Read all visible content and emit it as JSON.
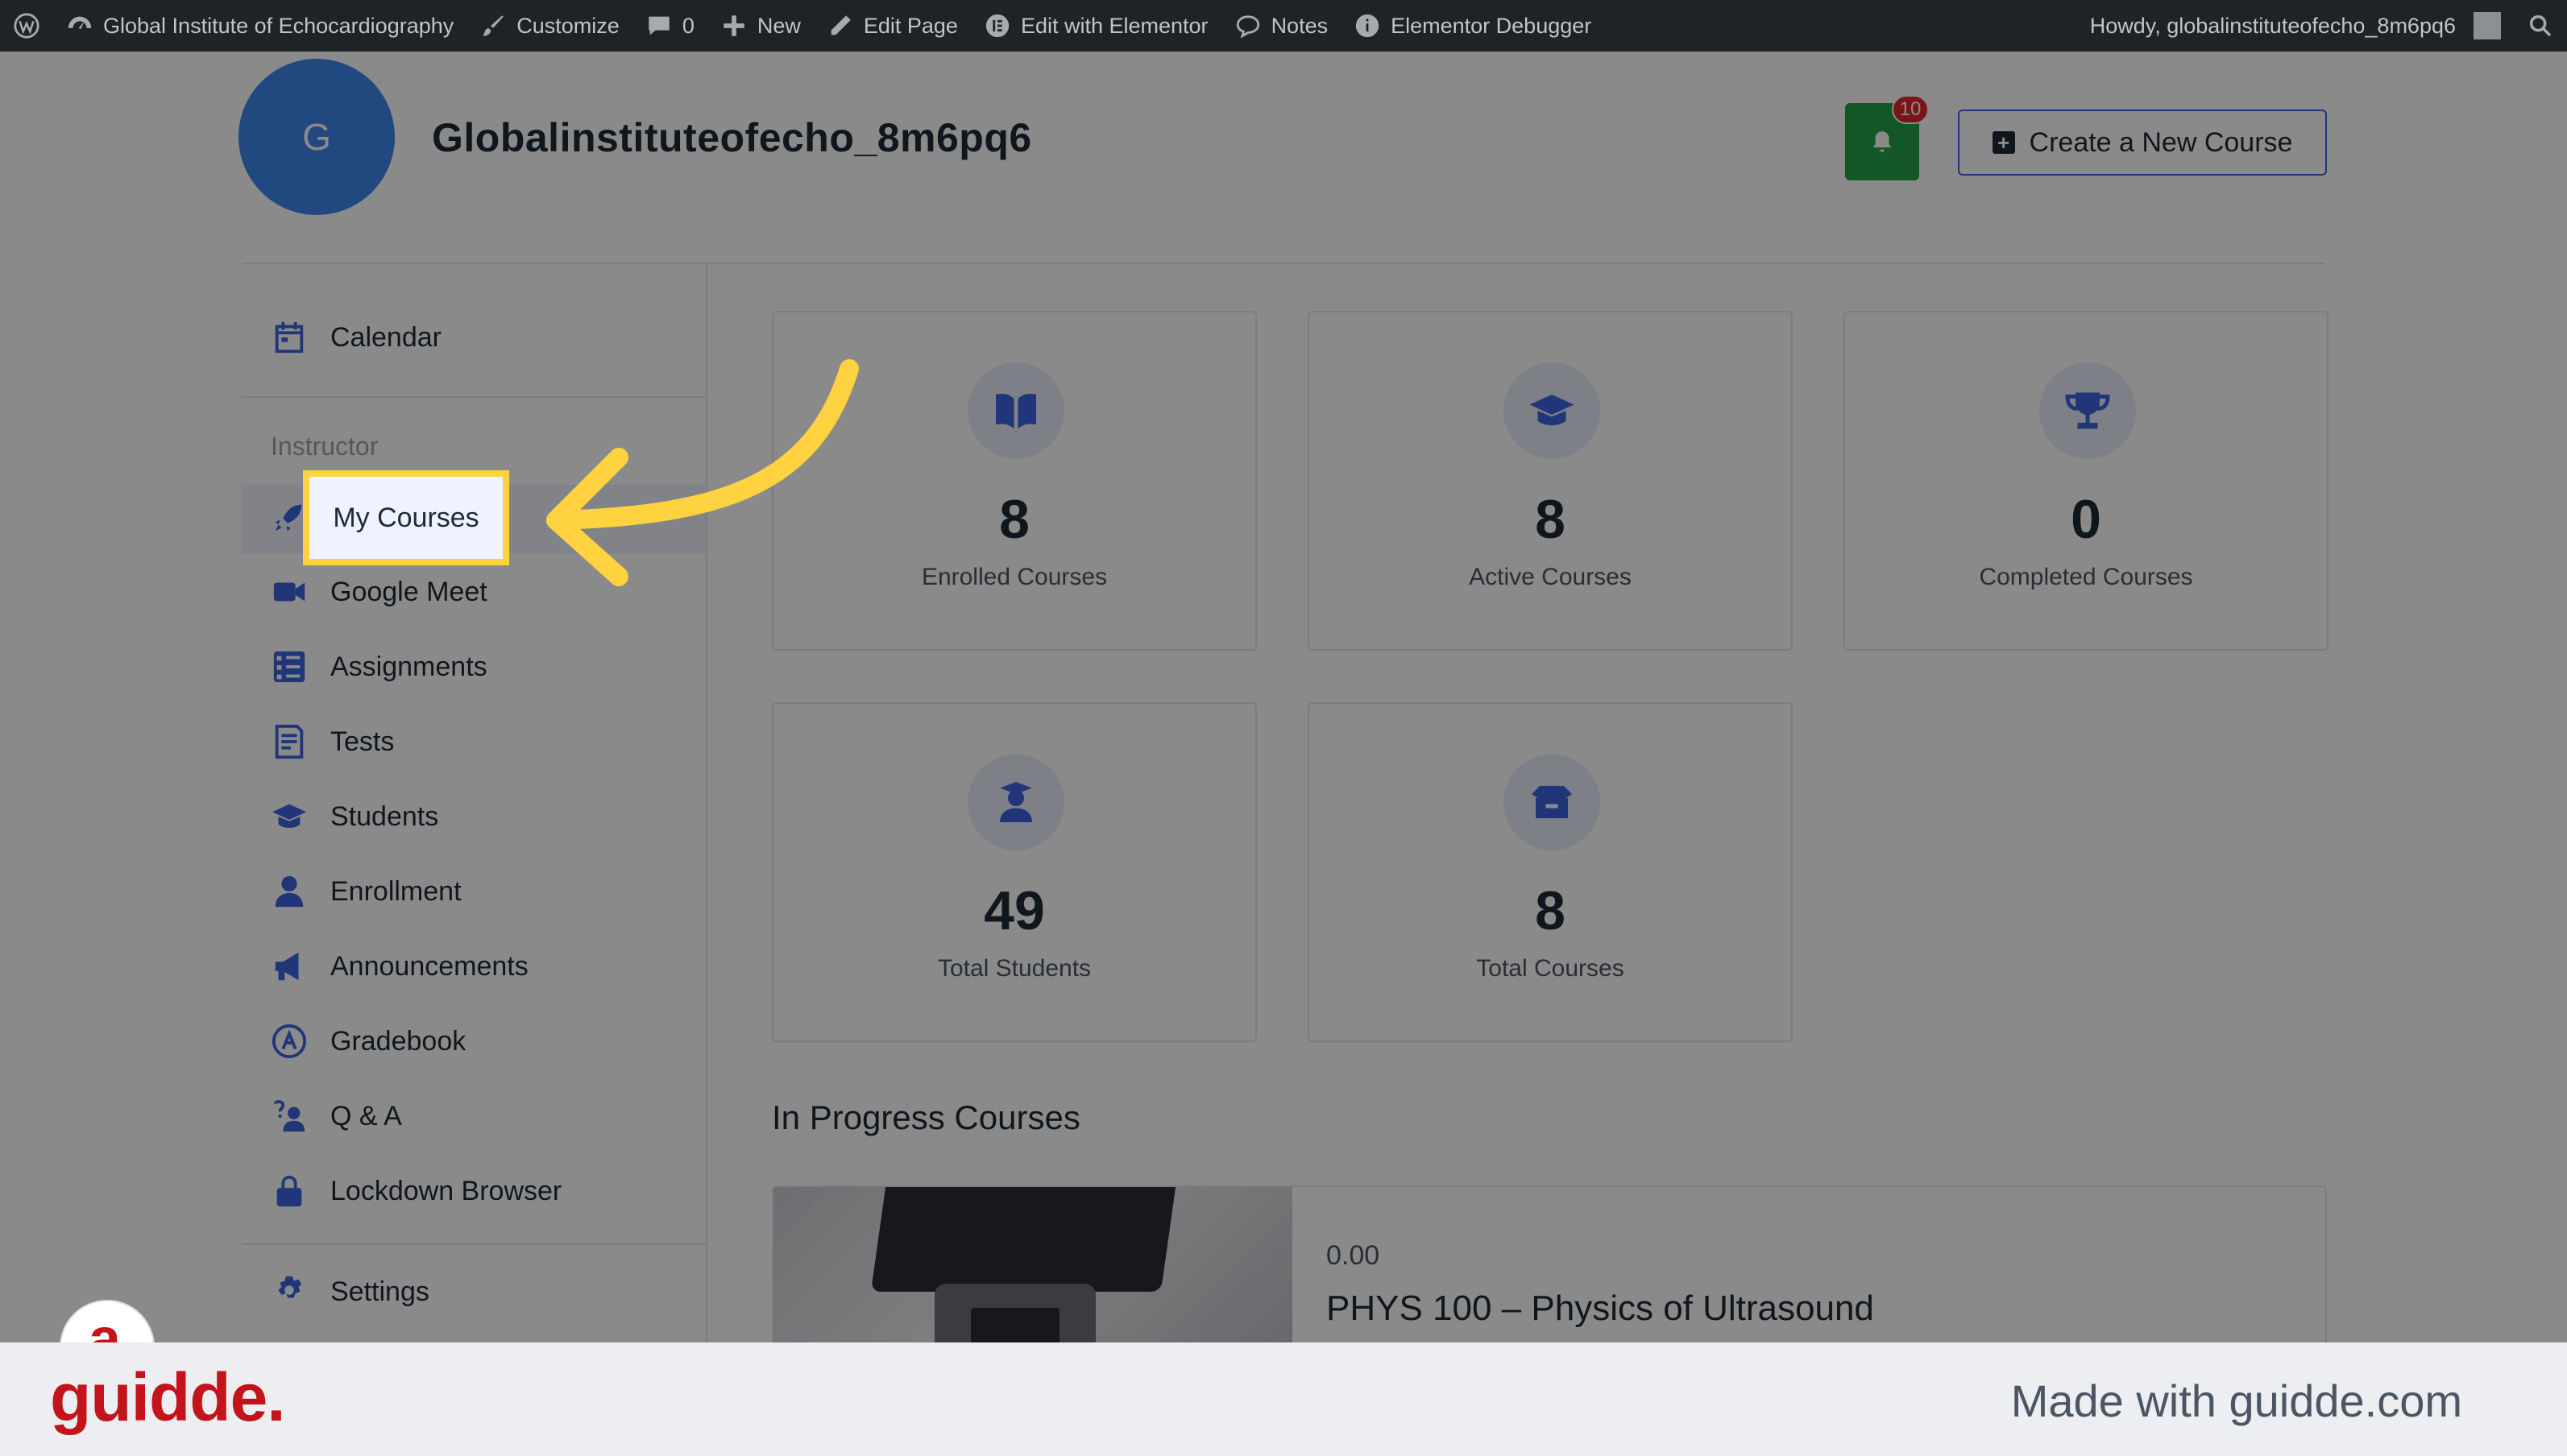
{
  "admin_bar": {
    "site_name": "Global Institute of Echocardiography",
    "customize": "Customize",
    "comments_count": "0",
    "new": "New",
    "edit_page": "Edit Page",
    "edit_elementor": "Edit with Elementor",
    "notes": "Notes",
    "debugger": "Elementor Debugger",
    "howdy": "Howdy, globalinstituteofecho_8m6pq6"
  },
  "header": {
    "avatar_initial": "G",
    "username": "Globalinstituteofecho_8m6pq6",
    "notification_count": "10",
    "create_course_label": "Create a New Course"
  },
  "sidebar": {
    "calendar": "Calendar",
    "instructor_heading": "Instructor",
    "items": [
      {
        "label": "My Courses",
        "icon": "rocket-icon"
      },
      {
        "label": "Google Meet",
        "icon": "video-icon"
      },
      {
        "label": "Assignments",
        "icon": "checklist-icon"
      },
      {
        "label": "Tests",
        "icon": "document-icon"
      },
      {
        "label": "Students",
        "icon": "graduation-cap-icon"
      },
      {
        "label": "Enrollment",
        "icon": "person-icon"
      },
      {
        "label": "Announcements",
        "icon": "megaphone-icon"
      },
      {
        "label": "Gradebook",
        "icon": "grade-icon"
      },
      {
        "label": "Q & A",
        "icon": "question-person-icon"
      },
      {
        "label": "Lockdown Browser",
        "icon": "lock-icon"
      }
    ],
    "settings": "Settings"
  },
  "stats": [
    {
      "value": "8",
      "label": "Enrolled Courses",
      "icon": "book-icon"
    },
    {
      "value": "8",
      "label": "Active Courses",
      "icon": "graduation-cap-icon"
    },
    {
      "value": "0",
      "label": "Completed Courses",
      "icon": "trophy-icon"
    },
    {
      "value": "49",
      "label": "Total Students",
      "icon": "student-icon"
    },
    {
      "value": "8",
      "label": "Total Courses",
      "icon": "box-icon"
    }
  ],
  "in_progress": {
    "title": "In Progress Courses",
    "course_price": "0.00",
    "course_name": "PHYS 100 – Physics of Ultrasound"
  },
  "footer": {
    "brand": "guidde.",
    "made_with": "Made with guidde.com"
  },
  "colors": {
    "accent": "#3e64de",
    "highlight": "#ffd23f",
    "brand_red": "#c4141b"
  }
}
